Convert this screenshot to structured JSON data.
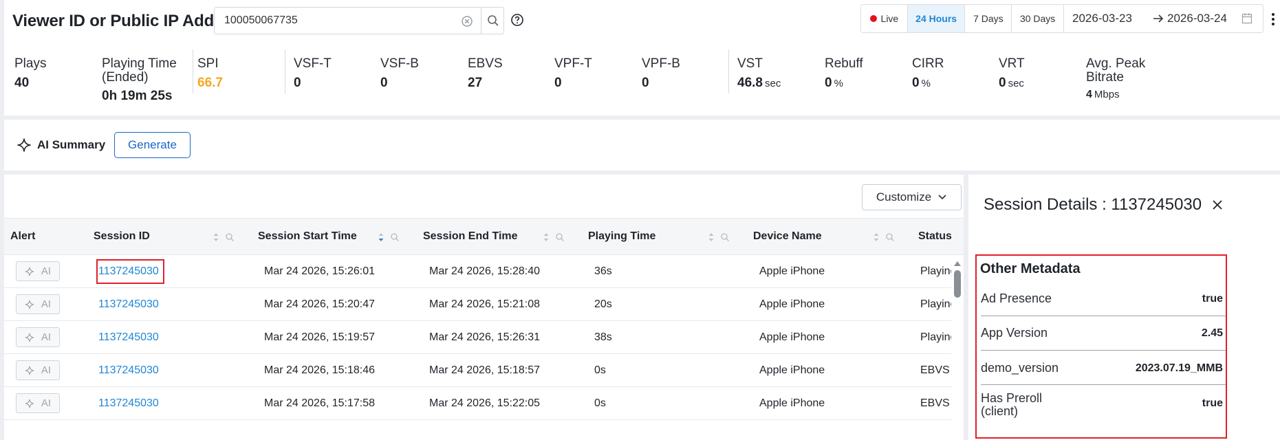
{
  "header": {
    "title": "Viewer ID or Public IP Address",
    "search_value": "100050067735",
    "range": {
      "live_label": "Live",
      "options": [
        "24 Hours",
        "7 Days",
        "30 Days"
      ],
      "selected": "24 Hours",
      "date_from": "2026-03-23",
      "date_to": "2026-03-24"
    }
  },
  "metrics": [
    {
      "label": "Plays",
      "value": "40",
      "unit": ""
    },
    {
      "label": "Playing Time (Ended)",
      "value": "0h 19m 25s",
      "unit": ""
    },
    {
      "label": "SPI",
      "value": "66.7",
      "unit": "",
      "color": "#f5a623"
    },
    {
      "label": "VSF-T",
      "value": "0",
      "unit": ""
    },
    {
      "label": "VSF-B",
      "value": "0",
      "unit": ""
    },
    {
      "label": "EBVS",
      "value": "27",
      "unit": ""
    },
    {
      "label": "VPF-T",
      "value": "0",
      "unit": ""
    },
    {
      "label": "VPF-B",
      "value": "0",
      "unit": ""
    },
    {
      "label": "VST",
      "value": "46.8",
      "unit": "sec"
    },
    {
      "label": "Rebuff",
      "value": "0",
      "unit": "%"
    },
    {
      "label": "CIRR",
      "value": "0",
      "unit": "%"
    },
    {
      "label": "VRT",
      "value": "0",
      "unit": "sec"
    },
    {
      "label": "Avg. Peak Bitrate",
      "value": "4",
      "unit": "Mbps"
    }
  ],
  "ai_summary": {
    "title": "AI Summary",
    "generate_label": "Generate"
  },
  "table": {
    "customize_label": "Customize",
    "columns": [
      "Alert",
      "Session ID",
      "Session Start Time",
      "Session End Time",
      "Playing Time",
      "Device Name",
      "Status"
    ],
    "ai_button_label": "AI",
    "rows": [
      {
        "session_id": "1137245030",
        "start": "Mar 24 2026, 15:26:01",
        "end": "Mar 24 2026, 15:28:40",
        "playing": "36s",
        "device": "Apple iPhone",
        "status": "Playing"
      },
      {
        "session_id": "1137245030",
        "start": "Mar 24 2026, 15:20:47",
        "end": "Mar 24 2026, 15:21:08",
        "playing": "20s",
        "device": "Apple iPhone",
        "status": "Playing"
      },
      {
        "session_id": "1137245030",
        "start": "Mar 24 2026, 15:19:57",
        "end": "Mar 24 2026, 15:26:31",
        "playing": "38s",
        "device": "Apple iPhone",
        "status": "Playing"
      },
      {
        "session_id": "1137245030",
        "start": "Mar 24 2026, 15:18:46",
        "end": "Mar 24 2026, 15:18:57",
        "playing": "0s",
        "device": "Apple iPhone",
        "status": "EBVS"
      },
      {
        "session_id": "1137245030",
        "start": "Mar 24 2026, 15:17:58",
        "end": "Mar 24 2026, 15:22:05",
        "playing": "0s",
        "device": "Apple iPhone",
        "status": "EBVS"
      }
    ]
  },
  "details": {
    "title": "Session Details : 1137245030",
    "section_title": "Other Metadata",
    "items": [
      {
        "key": "Ad Presence",
        "value": "true"
      },
      {
        "key": "App Version",
        "value": "2.45"
      },
      {
        "key": "demo_version",
        "value": "2023.07.19_MMB"
      },
      {
        "key": "Has Preroll (client)",
        "value": "true"
      }
    ]
  },
  "colors": {
    "accent": "#1f86d6",
    "spi": "#f5a623",
    "live": "#e5121c",
    "highlight": "#e0202a"
  }
}
